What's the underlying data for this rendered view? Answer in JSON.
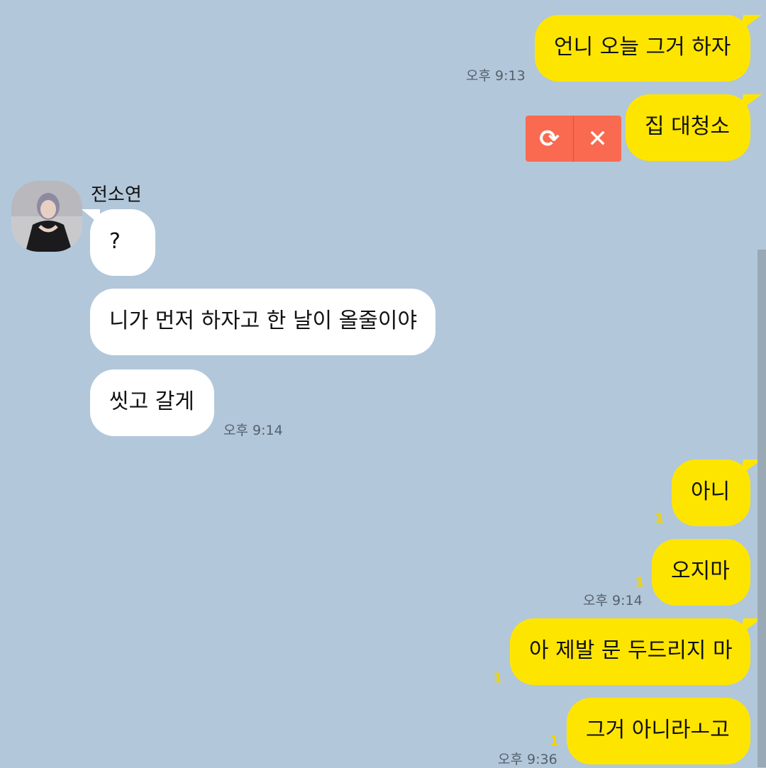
{
  "chat": {
    "sender_name": "전소연",
    "messages": [
      {
        "from": "me",
        "text": "언니 오늘 그거 하자",
        "time": "오후 9:13"
      },
      {
        "from": "me",
        "text": "집 대청소",
        "status": "failed"
      },
      {
        "from": "them",
        "text": "?"
      },
      {
        "from": "them",
        "text": "니가 먼저 하자고 한 날이 올줄이야"
      },
      {
        "from": "them",
        "text": "씻고 갈게",
        "time": "오후 9:14"
      },
      {
        "from": "me",
        "text": "아니",
        "unread": "1"
      },
      {
        "from": "me",
        "text": "오지마",
        "unread": "1",
        "time": "오후 9:14"
      },
      {
        "from": "me",
        "text": "아 제발 문 두드리지 마",
        "unread": "1"
      },
      {
        "from": "me",
        "text": "그거 아니라ㅗ고",
        "unread": "1",
        "time": "오후 9:36"
      }
    ]
  },
  "failed_actions": {
    "retry_icon": "retry-icon",
    "delete_icon": "close-icon",
    "retry_glyph": "⟳",
    "delete_glyph": "✕"
  },
  "colors": {
    "background": "#b2c7da",
    "my_bubble": "#fee500",
    "their_bubble": "#ffffff",
    "unread_count": "#f2d400",
    "failed_box": "#f96a50"
  }
}
